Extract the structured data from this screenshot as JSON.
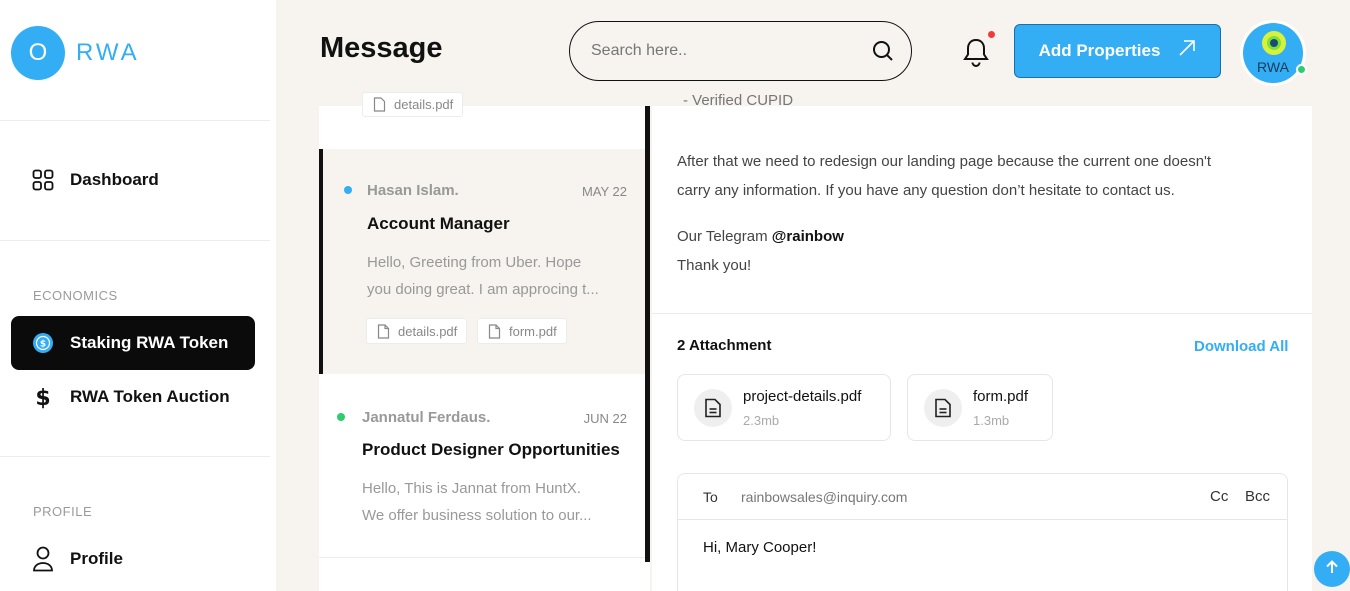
{
  "brand": {
    "logo_letter": "O",
    "name": "RWA"
  },
  "sidebar": {
    "dashboard": "Dashboard",
    "economics_label": "ECONOMICS",
    "staking": "Staking RWA Token",
    "auction": "RWA Token Auction",
    "profile_label": "PROFILE",
    "profile": "Profile"
  },
  "header": {
    "title": "Message",
    "search_placeholder": "Search here..",
    "add_button": "Add Properties",
    "avatar_text": "RWA"
  },
  "messages": {
    "top_chip": "details.pdf",
    "items": [
      {
        "name": "Hasan Islam.",
        "date": "MAY 22",
        "subject": "Account Manager",
        "snippet1": "Hello, Greeting from Uber. Hope",
        "snippet2": "you doing great. I am approcing t...",
        "attachments": [
          "details.pdf",
          "form.pdf"
        ]
      },
      {
        "name": "Jannatul Ferdaus.",
        "date": "JUN 22",
        "subject": "Product Designer Opportunities",
        "snippet1": "Hello, This is Jannat from HuntX.",
        "snippet2": "We offer business solution to our..."
      }
    ]
  },
  "detail": {
    "cut_text": "- Verified CUPID",
    "para1_line1": "After that we need to redesign our landing page because the current one doesn't",
    "para1_line2": "carry any information. If you have any question don’t hesitate to contact us.",
    "telegram_prefix": "Our Telegram",
    "telegram_handle": "@rainbow",
    "thanks": "Thank you!",
    "attachment_title": "2 Attachment",
    "download_all": "Download All",
    "attachments": [
      {
        "name": "project-details.pdf",
        "size": "2.3mb"
      },
      {
        "name": "form.pdf",
        "size": "1.3mb"
      }
    ],
    "reply": {
      "to_label": "To",
      "to_address": "rainbowsales@inquiry.com",
      "cc": "Cc",
      "bcc": "Bcc",
      "body": "Hi, Mary Cooper!"
    }
  },
  "colors": {
    "accent": "#33aef5",
    "background": "#f7f3ef",
    "active_nav": "#0b0b0b",
    "unread_blue": "#33aef5",
    "unread_green": "#2ecc71",
    "notification": "#f23a3a"
  }
}
